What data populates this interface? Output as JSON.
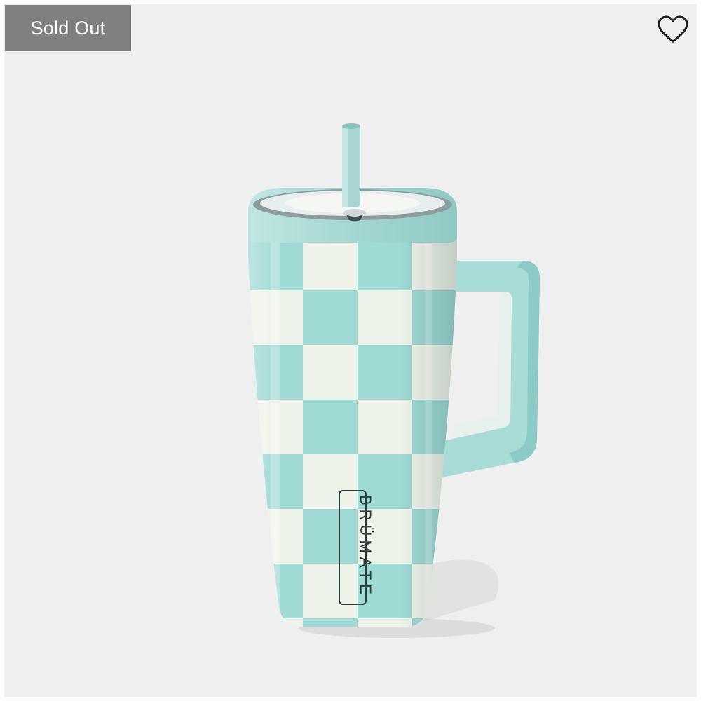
{
  "badge": {
    "label": "Sold Out"
  },
  "wishlist": {
    "icon": "heart-outline-icon"
  },
  "product": {
    "brand_mark": "BRÜMATE",
    "colors": {
      "teal": "#9fdad5",
      "cream": "#eef3e9",
      "handle": "#a8dcd6",
      "lid": "#a6d6d2"
    }
  }
}
